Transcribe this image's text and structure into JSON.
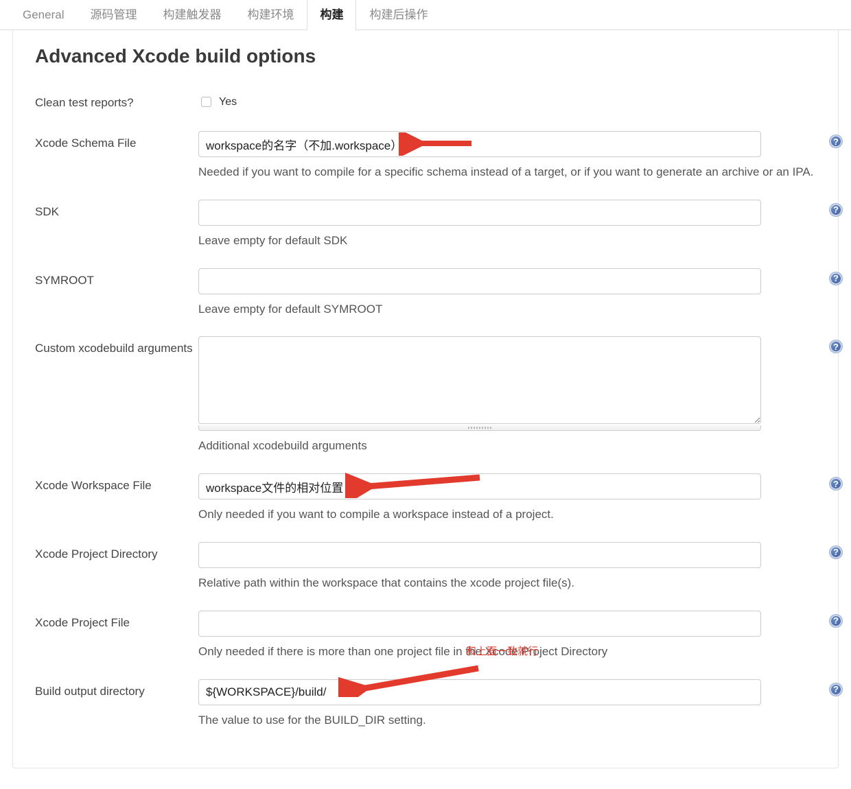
{
  "tabs": [
    {
      "label": "General"
    },
    {
      "label": "源码管理"
    },
    {
      "label": "构建触发器"
    },
    {
      "label": "构建环境"
    },
    {
      "label": "构建",
      "active": true
    },
    {
      "label": "构建后操作"
    }
  ],
  "section_title": "Advanced Xcode build options",
  "help_glyph": "?",
  "fields": {
    "clean_test_reports": {
      "label": "Clean test reports?",
      "checkbox_text": "Yes",
      "checked": false
    },
    "schema_file": {
      "label": "Xcode Schema File",
      "value": "workspace的名字（不加.workspace）",
      "hint": "Needed if you want to compile for a specific schema instead of a target, or if you want to generate an archive or an IPA."
    },
    "sdk": {
      "label": "SDK",
      "value": "",
      "hint": "Leave empty for default SDK"
    },
    "symroot": {
      "label": "SYMROOT",
      "value": "",
      "hint": "Leave empty for default SYMROOT"
    },
    "custom_args": {
      "label": "Custom xcodebuild arguments",
      "value": "",
      "hint": "Additional xcodebuild arguments"
    },
    "workspace_file": {
      "label": "Xcode Workspace File",
      "value": "workspace文件的相对位置",
      "hint": "Only needed if you want to compile a workspace instead of a project."
    },
    "project_dir": {
      "label": "Xcode Project Directory",
      "value": "",
      "hint": "Relative path within the workspace that contains the xcode project file(s)."
    },
    "project_file": {
      "label": "Xcode Project File",
      "value": "",
      "hint": "Only needed if there is more than one project file in the Xcode Project Directory"
    },
    "build_output_dir": {
      "label": "Build output directory",
      "value": "${WORKSPACE}/build/",
      "hint": "The value to use for the BUILD_DIR setting."
    }
  },
  "annotations": {
    "red_note_text": "和上面一致就行"
  }
}
